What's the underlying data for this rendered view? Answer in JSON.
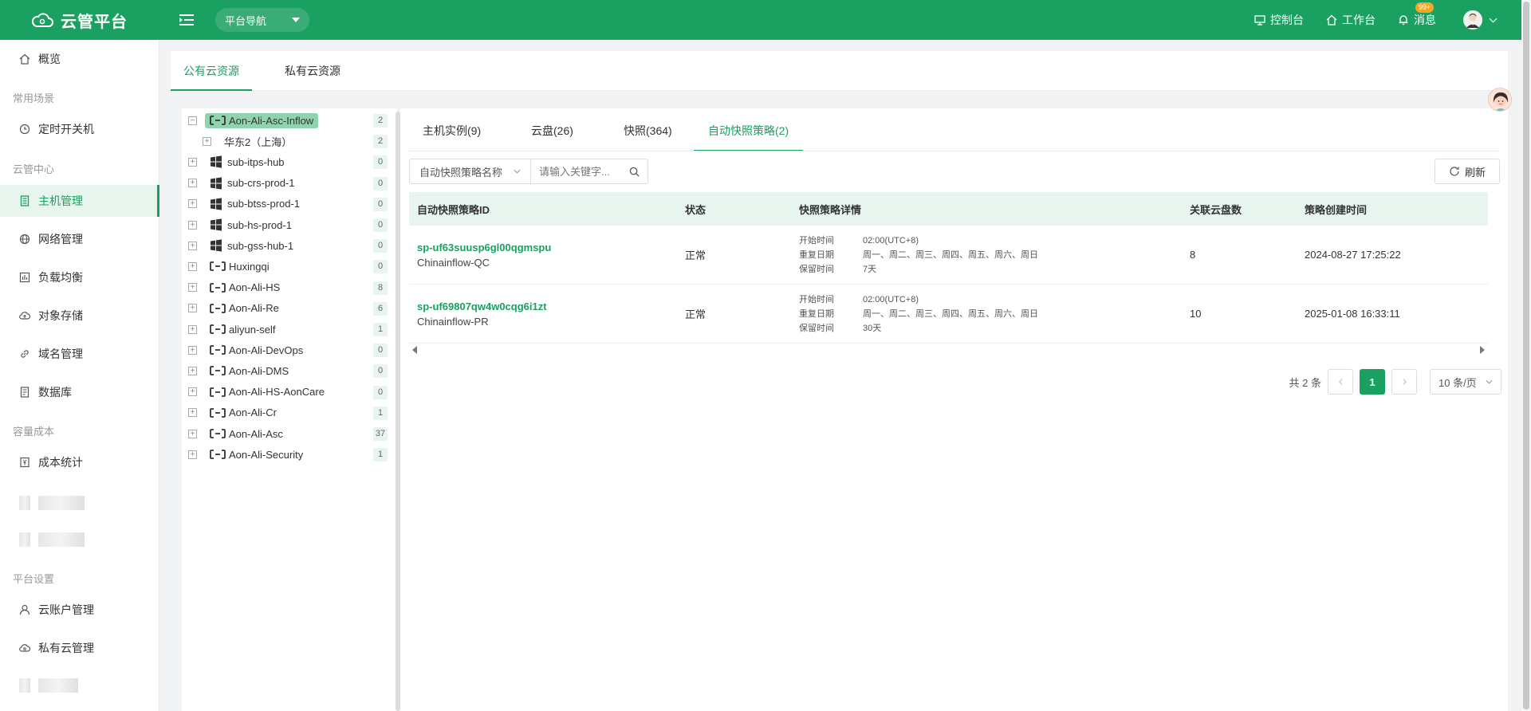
{
  "header": {
    "logo_text": "云管平台",
    "nav_select": "平台导航",
    "console": "控制台",
    "workbench": "工作台",
    "messages": "消息",
    "message_badge": "99+"
  },
  "sidebar": {
    "overview": "概览",
    "group_common": "常用场景",
    "scheduled_power": "定时开关机",
    "group_cloud": "云管中心",
    "host_mgmt": "主机管理",
    "network_mgmt": "网络管理",
    "load_balance": "负载均衡",
    "object_storage": "对象存储",
    "domain_mgmt": "域名管理",
    "database": "数据库",
    "group_cost": "容量成本",
    "cost_stats": "成本统计",
    "group_settings": "平台设置",
    "cloud_accounts": "云账户管理",
    "private_cloud": "私有云管理"
  },
  "top_tabs": {
    "public": "公有云资源",
    "private": "私有云资源"
  },
  "tree": [
    {
      "label": "Aon-Ali-Asc-Inflow",
      "count": "2",
      "icon": "aliyun-icon",
      "expanded": true,
      "selected": true
    },
    {
      "label": "华东2（上海）",
      "count": "2",
      "icon": "none",
      "child": true
    },
    {
      "label": "sub-itps-hub",
      "count": "0",
      "icon": "windows-icon"
    },
    {
      "label": "sub-crs-prod-1",
      "count": "0",
      "icon": "windows-icon"
    },
    {
      "label": "sub-btss-prod-1",
      "count": "0",
      "icon": "windows-icon"
    },
    {
      "label": "sub-hs-prod-1",
      "count": "0",
      "icon": "windows-icon"
    },
    {
      "label": "sub-gss-hub-1",
      "count": "0",
      "icon": "windows-icon"
    },
    {
      "label": "Huxingqi",
      "count": "0",
      "icon": "aliyun-icon"
    },
    {
      "label": "Aon-Ali-HS",
      "count": "8",
      "icon": "aliyun-icon"
    },
    {
      "label": "Aon-Ali-Re",
      "count": "6",
      "icon": "aliyun-icon"
    },
    {
      "label": "aliyun-self",
      "count": "1",
      "icon": "aliyun-icon"
    },
    {
      "label": "Aon-Ali-DevOps",
      "count": "0",
      "icon": "aliyun-icon"
    },
    {
      "label": "Aon-Ali-DMS",
      "count": "0",
      "icon": "aliyun-icon"
    },
    {
      "label": "Aon-Ali-HS-AonCare",
      "count": "0",
      "icon": "aliyun-icon"
    },
    {
      "label": "Aon-Ali-Cr",
      "count": "1",
      "icon": "aliyun-icon"
    },
    {
      "label": "Aon-Ali-Asc",
      "count": "37",
      "icon": "aliyun-icon"
    },
    {
      "label": "Aon-Ali-Security",
      "count": "1",
      "icon": "aliyun-icon"
    }
  ],
  "sub_tabs": {
    "instances": "主机实例(9)",
    "disks": "云盘(26)",
    "snapshots": "快照(364)",
    "auto_policy": "自动快照策略(2)"
  },
  "filter": {
    "field": "自动快照策略名称",
    "placeholder": "请输入关键字..."
  },
  "refresh_label": "刷新",
  "table": {
    "headers": {
      "id": "自动快照策略ID",
      "status": "状态",
      "detail": "快照策略详情",
      "disks": "关联云盘数",
      "created": "策略创建时间"
    },
    "detail_keys": {
      "start": "开始时间",
      "repeat": "重复日期",
      "retain": "保留时间"
    },
    "rows": [
      {
        "id": "sp-uf63suusp6gl00qgmspu",
        "name": "Chinainflow-QC",
        "status": "正常",
        "start": "02:00(UTC+8)",
        "repeat": "周一、周二、周三、周四、周五、周六、周日",
        "retain": "7天",
        "disks": "8",
        "created": "2024-08-27 17:25:22"
      },
      {
        "id": "sp-uf69807qw4w0cqg6i1zt",
        "name": "Chinainflow-PR",
        "status": "正常",
        "start": "02:00(UTC+8)",
        "repeat": "周一、周二、周三、周四、周五、周六、周日",
        "retain": "30天",
        "disks": "10",
        "created": "2025-01-08 16:33:11"
      }
    ]
  },
  "pagination": {
    "total": "共 2 条",
    "current": "1",
    "page_size": "10 条/页"
  },
  "colors": {
    "brand": "#1aa060",
    "active_bg": "#e8f5ee"
  }
}
